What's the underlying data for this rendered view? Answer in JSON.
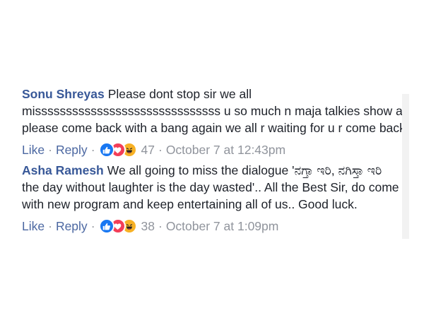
{
  "comments": [
    {
      "author": "Sonu Shreyas",
      "lines": [
        "Please dont stop sir we all",
        "missssssssssssssssssssssssssssss u so much n maja talkies show also.",
        "please come back with a bang again we all r waiting for u r come back"
      ],
      "actions": {
        "like": "Like",
        "sep1": "·",
        "reply": "Reply",
        "sep2": "·",
        "count": "47",
        "sep3": "·",
        "time": "October 7 at 12:43pm"
      },
      "reactions": [
        "like-icon",
        "love-icon",
        "haha-icon"
      ]
    },
    {
      "author": "Asha Ramesh",
      "lines": [
        "We all going to miss the dialogue 'ನಗ್ತಾ ಇರಿ, ನಗಿಸ್ತಾ ಇರಿ",
        "the day without laughter is the day wasted'.. All the Best Sir, do come up",
        "with new program and keep entertaining all of us.. Good luck."
      ],
      "actions": {
        "like": "Like",
        "sep1": "·",
        "reply": "Reply",
        "sep2": "·",
        "count": "38",
        "sep3": "·",
        "time": "October 7 at 1:09pm"
      },
      "reactions": [
        "like-icon",
        "love-icon",
        "haha-icon"
      ]
    }
  ],
  "colors": {
    "author": "#385898",
    "link": "#4b67a1",
    "meta": "#90949c",
    "like": "#1877f2",
    "love": "#f33e58",
    "haha": "#f7b125"
  }
}
